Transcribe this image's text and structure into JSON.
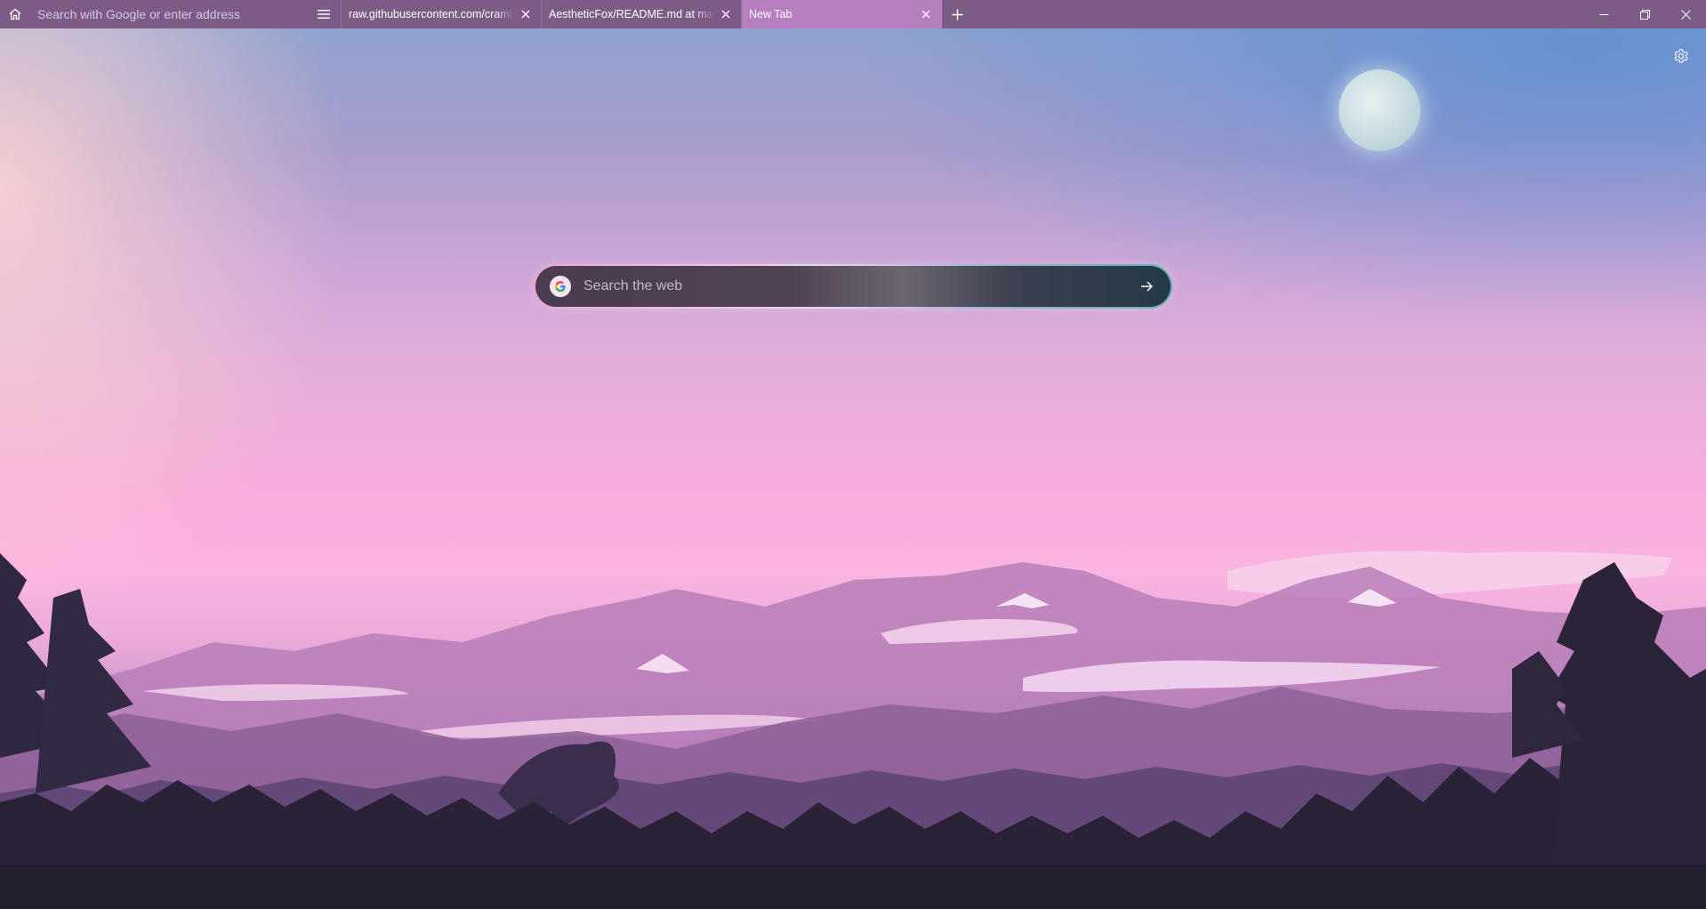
{
  "toolbar": {
    "home_icon": "home-icon",
    "address_placeholder": "Search with Google or enter address",
    "menu_icon": "hamburger-menu-icon"
  },
  "tabs": [
    {
      "label": "raw.githubusercontent.com/cramba",
      "active": false
    },
    {
      "label": "AestheticFox/README.md at main",
      "active": false
    },
    {
      "label": "New Tab",
      "active": true
    }
  ],
  "new_tab_icon": "plus-icon",
  "window_controls": {
    "minimize_icon": "minimize-icon",
    "restore_icon": "restore-icon",
    "close_icon": "close-icon"
  },
  "newtab": {
    "settings_icon": "gear-icon",
    "search": {
      "engine_icon": "google-icon",
      "placeholder": "Search the web",
      "submit_icon": "arrow-right-icon"
    }
  },
  "colors": {
    "toolbar_bg": "#7d5b87",
    "active_tab_bg": "#b67fc0"
  }
}
